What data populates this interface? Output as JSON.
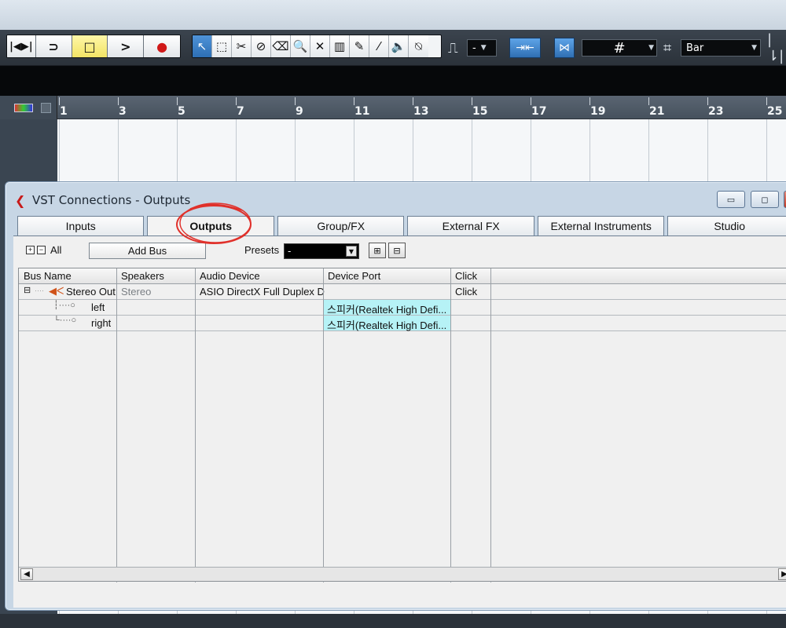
{
  "toolbar": {
    "transport": [
      {
        "name": "go-to-start",
        "glyph": "|◀▶|"
      },
      {
        "name": "cycle",
        "glyph": "⊃"
      },
      {
        "name": "stop",
        "glyph": "□"
      },
      {
        "name": "play",
        "glyph": ">"
      },
      {
        "name": "record",
        "glyph": "●"
      }
    ],
    "tools": [
      "↖",
      "⬚",
      "✂",
      "⊘",
      "⌫",
      "🔍",
      "✕",
      "▥",
      "✎",
      "⁄",
      "🔈",
      "⍉"
    ],
    "snap_value": "-",
    "grid_type": "Bar",
    "grid_symbol": "#"
  },
  "ruler": {
    "marks": [
      "1",
      "3",
      "5",
      "7",
      "9",
      "11",
      "13",
      "15",
      "17",
      "19",
      "21",
      "23",
      "25"
    ]
  },
  "window": {
    "title": "VST Connections - Outputs",
    "tabs": [
      "Inputs",
      "Outputs",
      "Group/FX",
      "External FX",
      "External Instruments",
      "Studio"
    ],
    "active_tab": "Outputs",
    "all_label": "All",
    "add_bus_label": "Add Bus",
    "presets_label": "Presets",
    "presets_value": "-"
  },
  "table": {
    "headers": [
      "Bus Name",
      "Speakers",
      "Audio Device",
      "Device Port",
      "Click"
    ],
    "rows": [
      {
        "bus": "Stereo Out",
        "speakers": "Stereo",
        "device": "ASIO DirectX Full Duplex D",
        "port": "",
        "click": "Click"
      },
      {
        "bus": "left",
        "speakers": "",
        "device": "",
        "port": "스피커(Realtek High Defi...",
        "click": ""
      },
      {
        "bus": "right",
        "speakers": "",
        "device": "",
        "port": "스피커(Realtek High Defi...",
        "click": ""
      }
    ]
  },
  "colors": {
    "accent_blue": "#2d6fb5",
    "record_red": "#d01818",
    "active_yellow": "#f2e465",
    "port_highlight": "#b6f2f6",
    "annotation_red": "#e0302a"
  }
}
